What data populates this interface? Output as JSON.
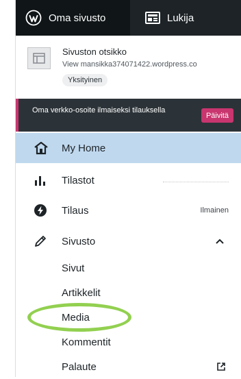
{
  "tabs": {
    "my_site": "Oma sivusto",
    "reader": "Lukija"
  },
  "site": {
    "title": "Sivuston otsikko",
    "url": "View mansikka374071422.wordpress.co",
    "visibility": "Yksityinen"
  },
  "upgrade": {
    "text": "Oma verkko-osoite ilmaiseksi tilauksella",
    "button": "Päivitä"
  },
  "menu": {
    "home": "My Home",
    "stats": "Tilastot",
    "plan": "Tilaus",
    "plan_badge": "Ilmainen",
    "site": "Sivusto"
  },
  "submenu": {
    "pages": "Sivut",
    "posts": "Artikkelit",
    "media": "Media",
    "comments": "Kommentit",
    "feedback": "Palaute"
  },
  "colors": {
    "active_bg": "#bfd8ee",
    "upgrade_accent": "#c9356e",
    "highlight": "#92d050"
  },
  "icons": [
    "wordpress-icon",
    "reader-icon",
    "site-thumbnail-icon",
    "home-icon",
    "stats-icon",
    "plan-icon",
    "pencil-icon",
    "chevron-up-icon",
    "external-link-icon"
  ]
}
